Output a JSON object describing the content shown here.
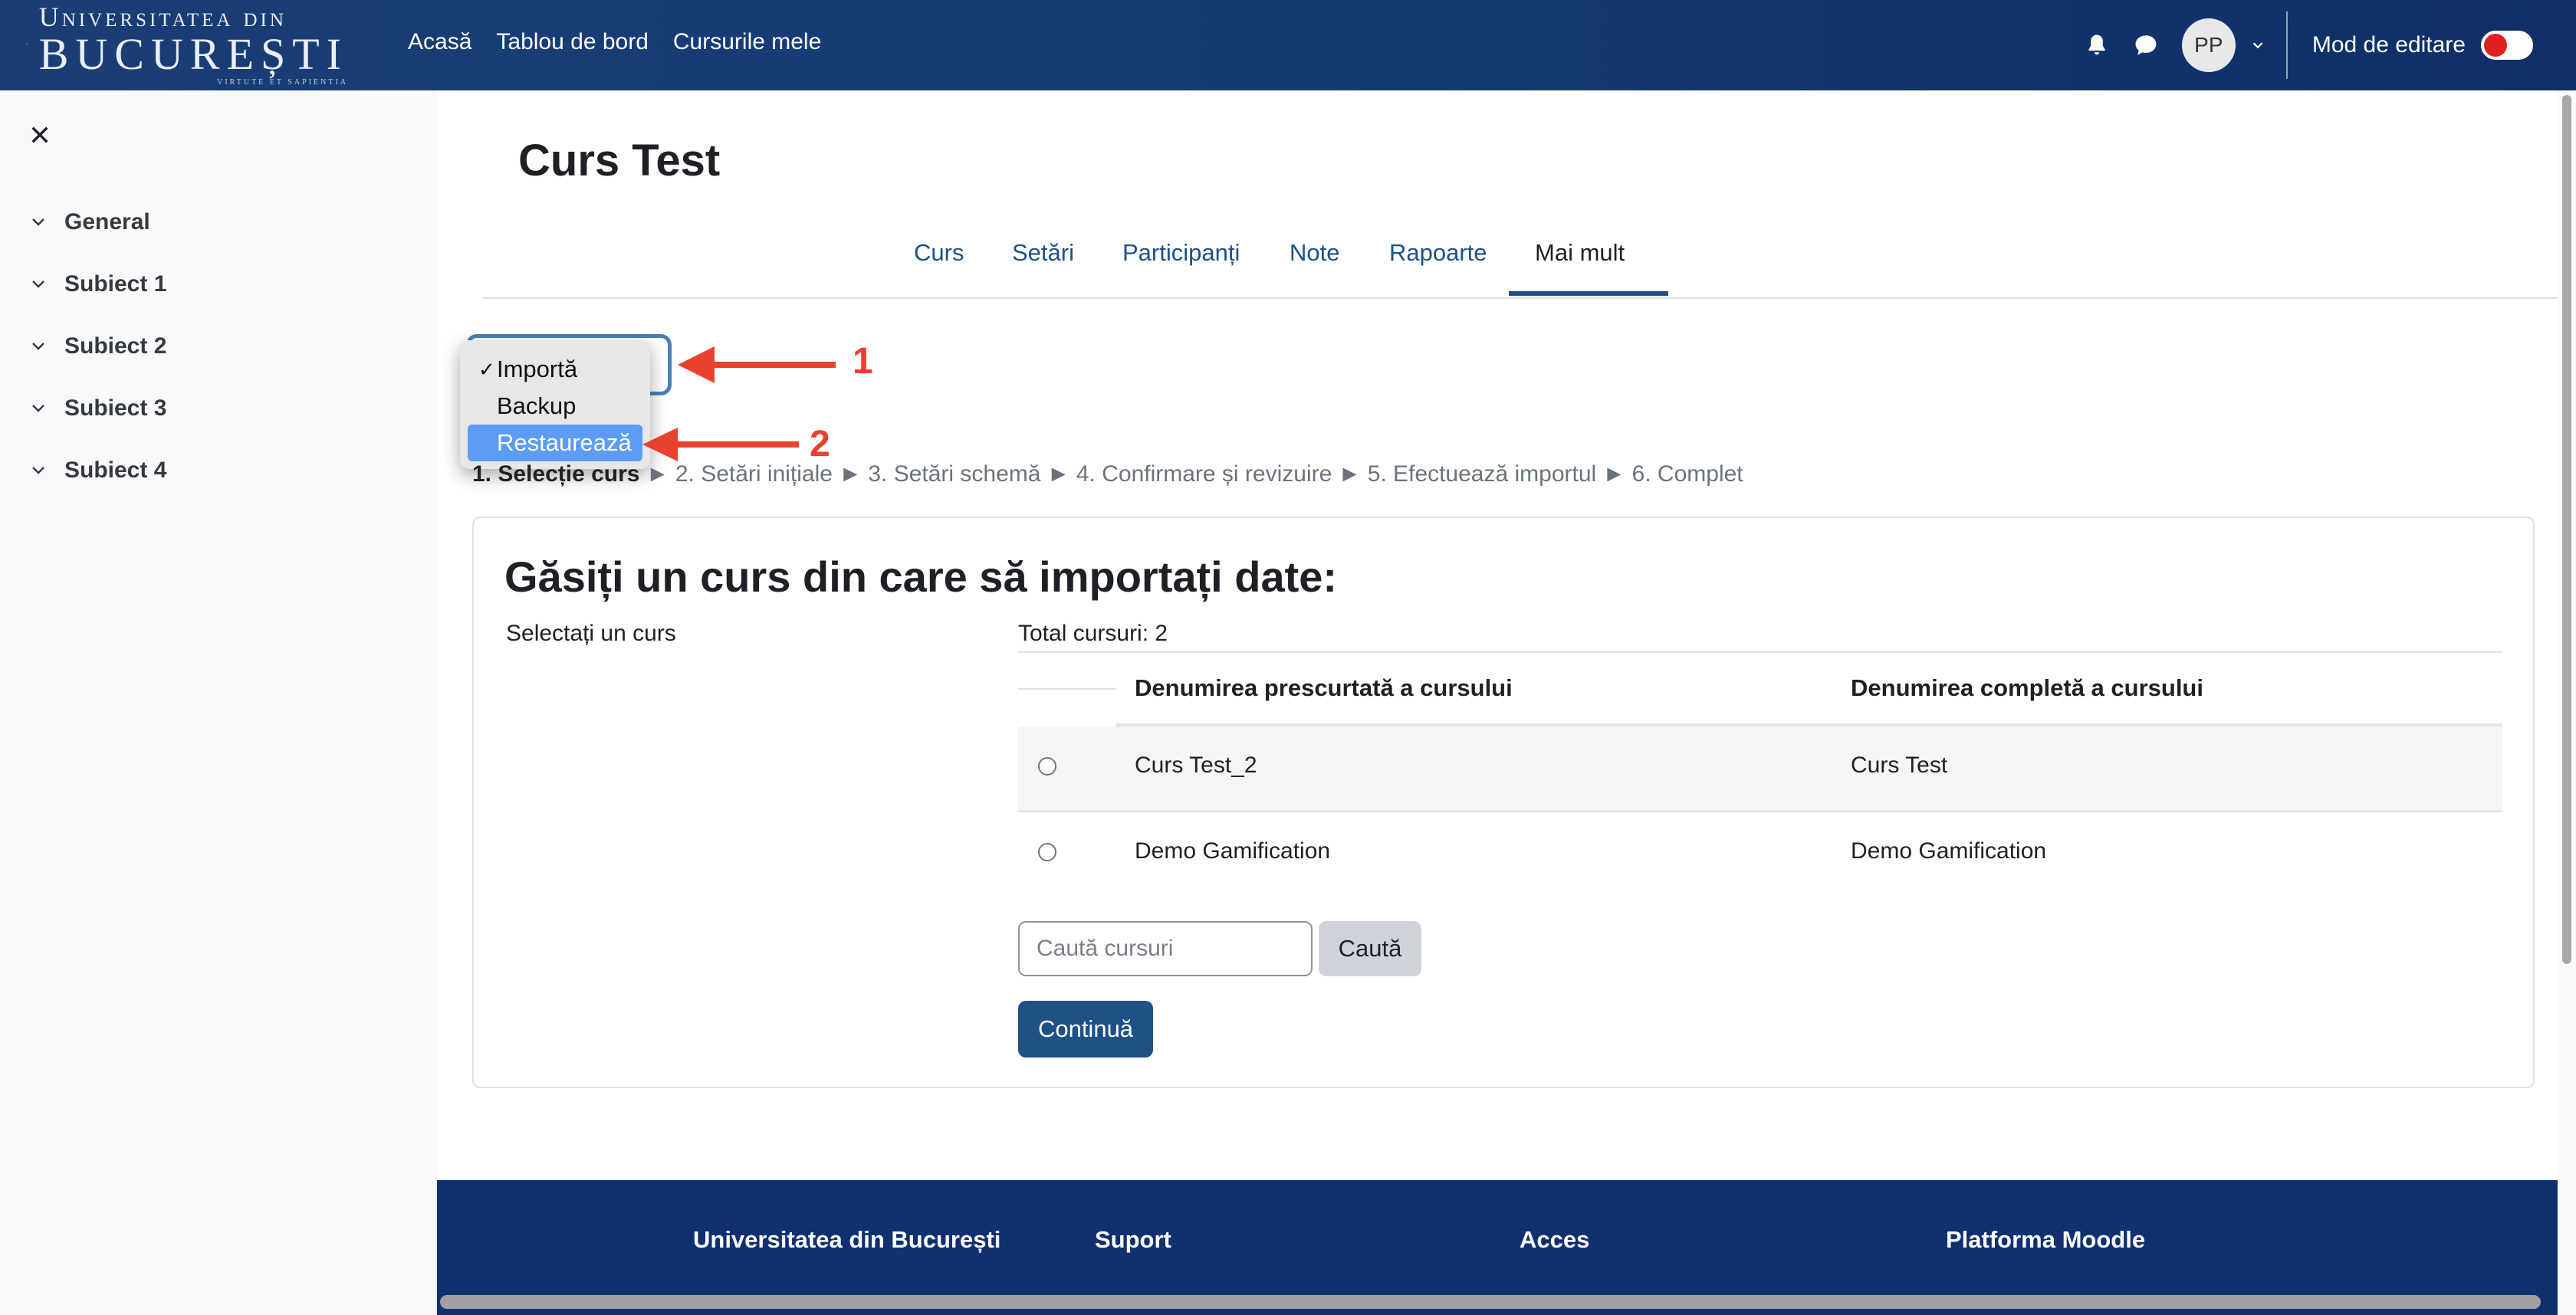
{
  "navbar": {
    "logo": {
      "line1": "Universitatea din",
      "line2": "BUCUREȘTI",
      "line3": "VIRTUTE ET SAPIENTIA"
    },
    "links": [
      "Acasă",
      "Tablou de bord",
      "Cursurile mele"
    ],
    "avatar_initials": "PP",
    "edit_mode_label": "Mod de editare",
    "edit_mode_on": false,
    "toggle_color": "#e02020"
  },
  "drawer": {
    "items": [
      "General",
      "Subiect 1",
      "Subiect 2",
      "Subiect 3",
      "Subiect 4"
    ]
  },
  "page": {
    "title": "Curs Test",
    "tabs": [
      "Curs",
      "Setări",
      "Participanți",
      "Note",
      "Rapoarte",
      "Mai mult"
    ],
    "active_tab": "Mai mult"
  },
  "dropdown": {
    "options": [
      "Importă",
      "Backup",
      "Restaurează"
    ],
    "checked": "Importă",
    "highlighted": "Restaurează",
    "check_mark": "✓"
  },
  "annotations": {
    "arrow1_label": "1",
    "arrow2_label": "2",
    "color": "#e8412c"
  },
  "steps": {
    "current": "1. Selecție curs",
    "separator": "►",
    "rest": [
      "2. Setări inițiale",
      "3. Setări schemă",
      "4. Confirmare și revizuire",
      "5. Efectuează importul",
      "6. Complet"
    ]
  },
  "card": {
    "title": "Găsiți un curs din care să importați date:",
    "select_label": "Selectați un curs",
    "total": "Total cursuri: 2",
    "columns": [
      "Denumirea prescurtată a cursului",
      "Denumirea completă a cursului"
    ],
    "rows": [
      {
        "short": "Curs Test_2",
        "full": "Curs Test"
      },
      {
        "short": "Demo Gamification",
        "full": "Demo Gamification"
      }
    ],
    "search_placeholder": "Caută cursuri",
    "search_button": "Caută",
    "continue_button": "Continuă"
  },
  "footer": {
    "columns": [
      "Universitatea din București",
      "Suport",
      "Acces",
      "Platforma Moodle"
    ]
  },
  "colors": {
    "navbar": "#153a73",
    "link": "#1f5086",
    "footer": "#10306f",
    "primary_button": "#1f5086"
  }
}
